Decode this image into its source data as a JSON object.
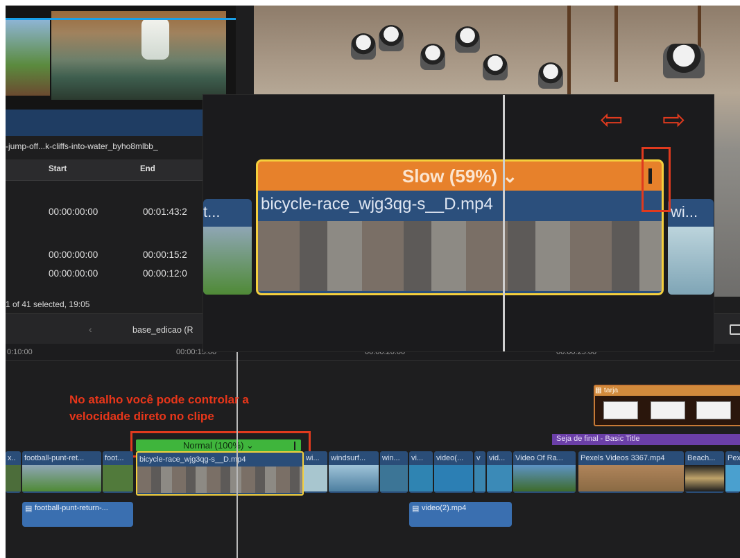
{
  "browser": {
    "clip_title": "-jump-off...k-cliffs-into-water_byho8mlbb_",
    "columns": {
      "start": "Start",
      "end": "End"
    },
    "rows": [
      {
        "start": "00:00:00:00",
        "end": "00:01:43:2"
      },
      {
        "start": "00:00:00:00",
        "end": "00:00:15:2"
      },
      {
        "start": "00:00:00:00",
        "end": "00:00:12:0"
      }
    ],
    "selection_status": "1 of 41 selected, 19:05"
  },
  "timeline": {
    "project_name": "base_edicao (R",
    "timecodes": [
      "0:10:00",
      "00:00:15:00",
      "00:00:20:00",
      "00:00:25:00"
    ],
    "speed_label": "Normal (100%) ⌄",
    "clips": [
      {
        "label": "x.."
      },
      {
        "label": "football-punt-ret..."
      },
      {
        "label": "foot..."
      },
      {
        "label": "bicycle-race_wjg3qg-s__D.mp4"
      },
      {
        "label": "wi..."
      },
      {
        "label": "windsurf..."
      },
      {
        "label": "win..."
      },
      {
        "label": "vi..."
      },
      {
        "label": "video(..."
      },
      {
        "label": "v"
      },
      {
        "label": "vid..."
      },
      {
        "label": "Video Of Ra..."
      },
      {
        "label": "Pexels Videos 3367.mp4"
      },
      {
        "label": "Beach..."
      },
      {
        "label": "Pex"
      }
    ],
    "connected": [
      {
        "label": "football-punt-return-..."
      },
      {
        "label": "video(2).mp4"
      }
    ],
    "title_clip": "Seja de final - Basic Title",
    "tarja_label": "tarja"
  },
  "zoom": {
    "speed_label": "Slow (59%) ⌄",
    "clip_name": "bicycle-race_wjg3qg-s__D.mp4",
    "left_clip": "t...",
    "right_clip": "wi..."
  },
  "annotation": {
    "line1": "No atalho você pode controlar a",
    "line2": "velocidade direto no clipe"
  },
  "colors": {
    "accent_red": "#e03a1e",
    "speed_slow": "#e7812b",
    "speed_normal": "#3fb53c",
    "selection_yellow": "#f4cf3d",
    "clip_blue": "#2a4d78"
  },
  "icons": [
    "chevron-left-icon",
    "dropdown-chevron-icon",
    "arrow-left-icon",
    "arrow-right-icon",
    "tarja-icon",
    "clip-icon",
    "window-icon"
  ]
}
